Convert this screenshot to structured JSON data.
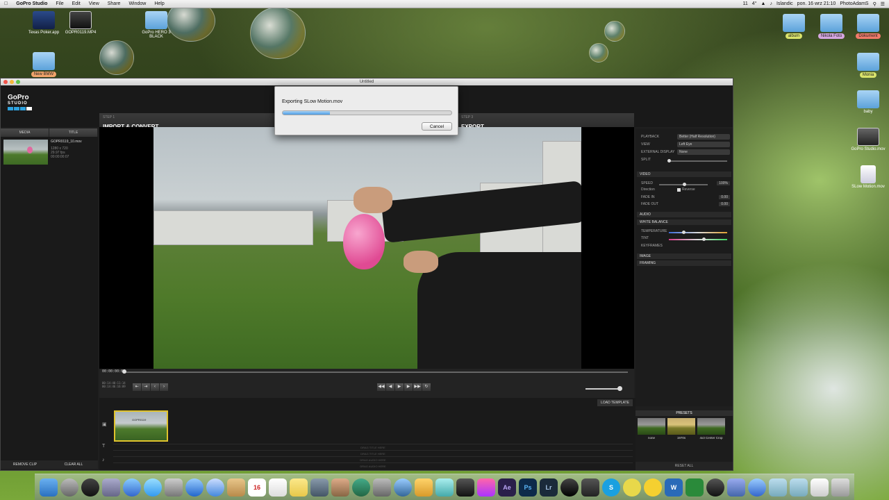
{
  "menubar": {
    "apple": "",
    "app_name": "GoPro Studio",
    "menus": [
      "File",
      "Edit",
      "View",
      "Share",
      "Window",
      "Help"
    ],
    "status": [
      "11",
      "4°",
      "Islandic",
      "pon. 16 wrz  21:10",
      "PhotoAdamS"
    ]
  },
  "desktop_icons": {
    "texas_poker": "Texas Poker.app",
    "gopro_mp4": "GOPR0119.MP4",
    "gopro_hero": "GoPro HERO 3 BLACK",
    "new_bmw": "New BMW",
    "album": "album",
    "nikola_foto": "Nikola Foto",
    "dokument": "Dokument",
    "monia": "Monia",
    "baby": "baby",
    "gopro_studio_mov": "GoPro Studio.mov",
    "slow_motion": "SLow Motion.mov"
  },
  "window": {
    "title": "Untitled",
    "logo_text": "GoPro",
    "logo_sub": "STUDIO",
    "step1_label": "STEP 1",
    "step1_name": "IMPORT & CONVERT",
    "step3_label": "STEP 3",
    "step3_name": "EXPORT"
  },
  "left_panel": {
    "tab_media": "MEDIA",
    "tab_title": "TITLE",
    "clip_name": "GOPR0119_10.mov",
    "clip_meta1": "1280 x 720",
    "clip_meta2": "29.97 fps",
    "clip_duration": "00:00:00:07",
    "remove_clip": "REMOVE CLIP",
    "clear_all": "CLEAR ALL"
  },
  "transport": {
    "timecode": "00:00:00:00",
    "tc_lines": [
      "00:14:40:11:14",
      "00:14:46:16:09"
    ]
  },
  "timeline": {
    "load_template": "LOAD TEMPLATE",
    "clip_label": "GOPR0119",
    "track_labels": [
      "DRAG TITLE HERE",
      "DRAG TITLE HERE",
      "DRAG AUDIO HERE",
      "DRAG AUDIO HERE"
    ]
  },
  "right_panel": {
    "playback_label": "PLAYBACK",
    "playback_value": "Better (Half Resolution)",
    "view_label": "VIEW",
    "view_value": "Left Eye",
    "external_label": "EXTERNAL DISPLAY",
    "external_value": "None",
    "split_label": "SPLIT",
    "video_section": "VIDEO",
    "speed_label": "SPEED",
    "speed_value": "100%",
    "direction_label": "Direction",
    "reverse_label": "Reverse",
    "fade_in_label": "FADE IN",
    "fade_in_value": "0.00",
    "fade_out_label": "FADE OUT",
    "fade_out_value": "0.00",
    "audio_section": "AUDIO",
    "white_balance_section": "WHITE BALANCE",
    "temperature_label": "TEMPERATURE",
    "tint_label": "TINT",
    "keyframes_label": "KEYFRAMES",
    "image_section": "IMAGE",
    "framing_section": "FRAMING"
  },
  "presets": {
    "title": "PRESETS",
    "items": [
      "none",
      "1970s",
      "4x3 Center Crop"
    ],
    "reset_all": "RESET ALL"
  },
  "export_dialog": {
    "title": "Exporting SLow Motion.mov",
    "progress": 0.28,
    "cancel": "Cancel"
  },
  "dock": {
    "labels": [
      "Ae",
      "Ps",
      "Lr",
      "16",
      "S",
      "W"
    ]
  }
}
